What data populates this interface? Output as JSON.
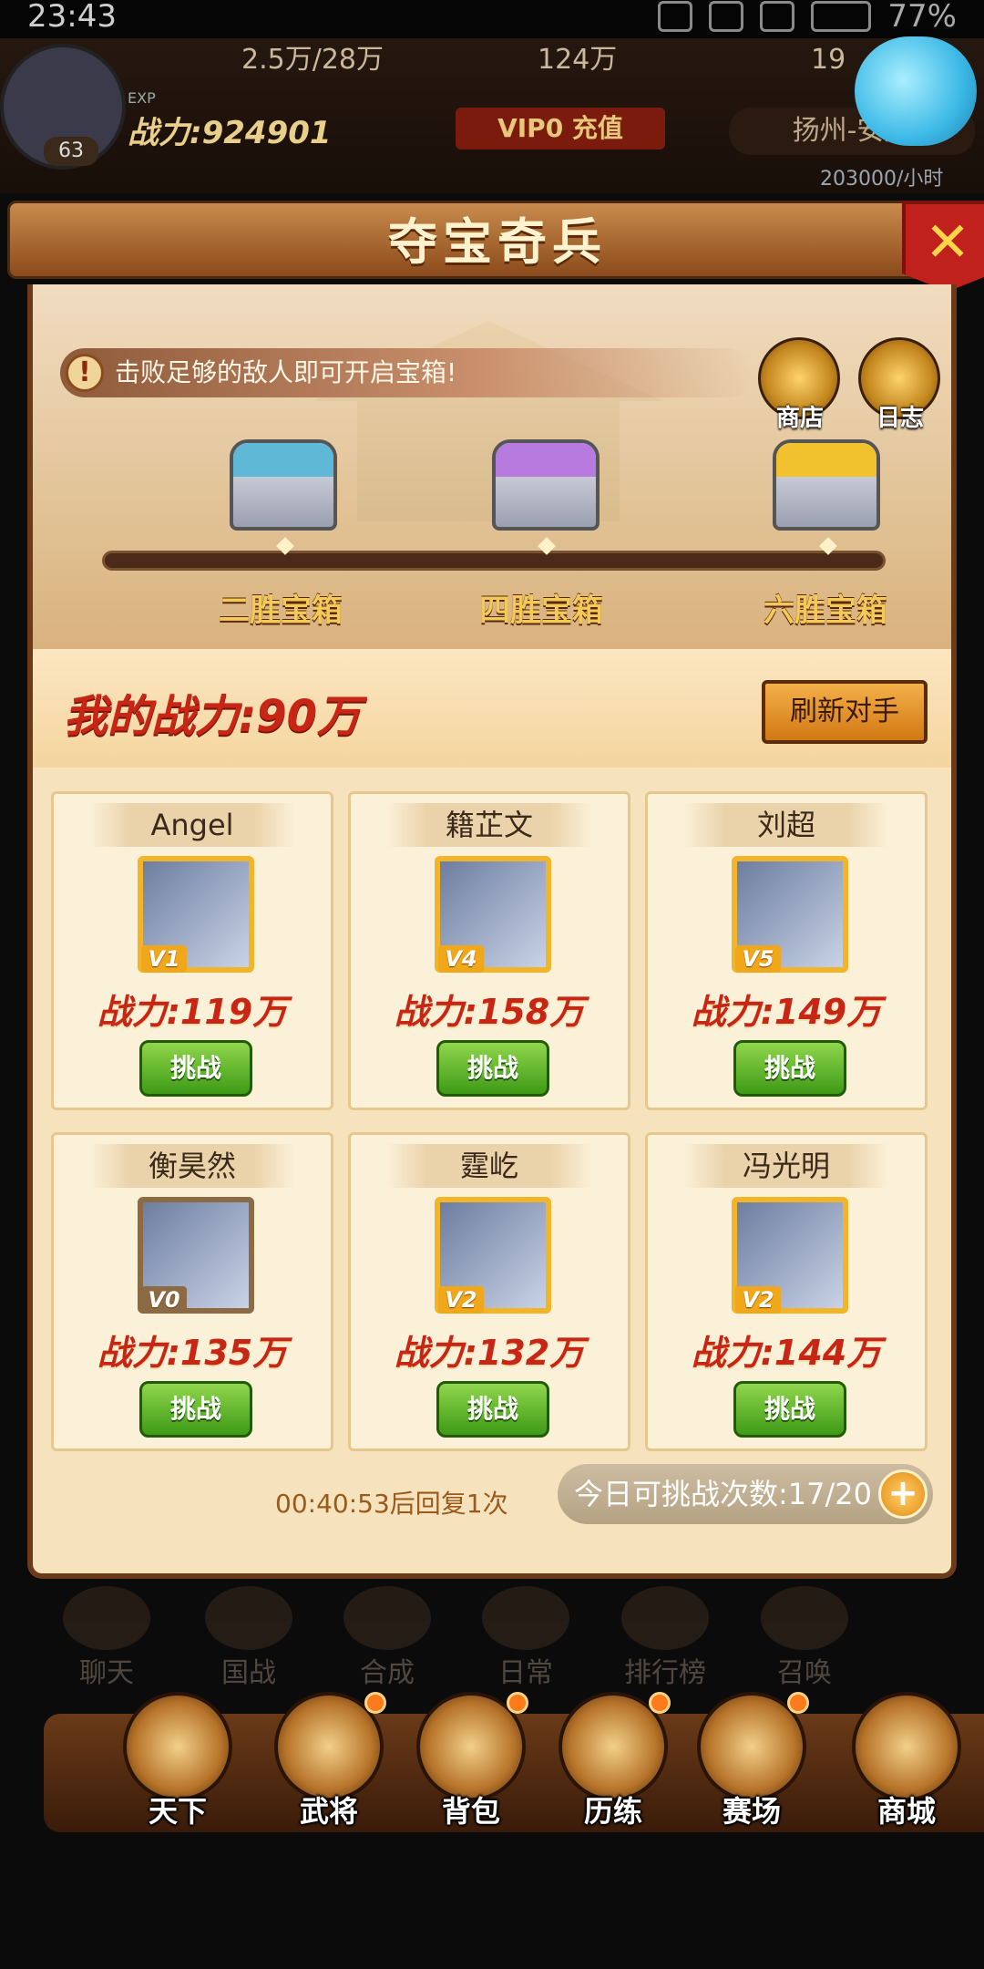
{
  "status_bar": {
    "time": "23:43",
    "battery": "77%"
  },
  "top_hud": {
    "resource_food": "2.5万/28万",
    "resource_coin": "124万",
    "resource_gold": "19",
    "power": "战力:924901",
    "exp_label": "EXP",
    "level": "63",
    "vip": "VIP0 充值",
    "location": "扬州-安成",
    "income": "203000/小时"
  },
  "modal": {
    "title": "夺宝奇兵",
    "notice": "击败足够的敌人即可开启宝箱!",
    "shop_label": "商店",
    "log_label": "日志",
    "chests": [
      {
        "label": "二胜宝箱",
        "color": "#5fb8d6"
      },
      {
        "label": "四胜宝箱",
        "color": "#b77be0"
      },
      {
        "label": "六胜宝箱",
        "color": "#f2c12e"
      }
    ],
    "my_power": "我的战力:90万",
    "refresh_label": "刷新对手",
    "opponents": [
      {
        "name": "Angel",
        "vip": "V1",
        "power": "战力:119万",
        "challenge": "挑战"
      },
      {
        "name": "籍芷文",
        "vip": "V4",
        "power": "战力:158万",
        "challenge": "挑战"
      },
      {
        "name": "刘超",
        "vip": "V5",
        "power": "战力:149万",
        "challenge": "挑战"
      },
      {
        "name": "衡昊然",
        "vip": "V0",
        "power": "战力:135万",
        "challenge": "挑战"
      },
      {
        "name": "霆屹",
        "vip": "V2",
        "power": "战力:132万",
        "challenge": "挑战"
      },
      {
        "name": "冯光明",
        "vip": "V2",
        "power": "战力:144万",
        "challenge": "挑战"
      }
    ],
    "recover_text": "00:40:53后回复1次",
    "attempts_text": "今日可挑战次数:17/20"
  },
  "mid_menu": [
    "聊天",
    "国战",
    "合成",
    "日常",
    "排行榜",
    "召唤"
  ],
  "bottom_nav": [
    "天下",
    "武将",
    "背包",
    "历练",
    "赛场",
    "商城"
  ]
}
